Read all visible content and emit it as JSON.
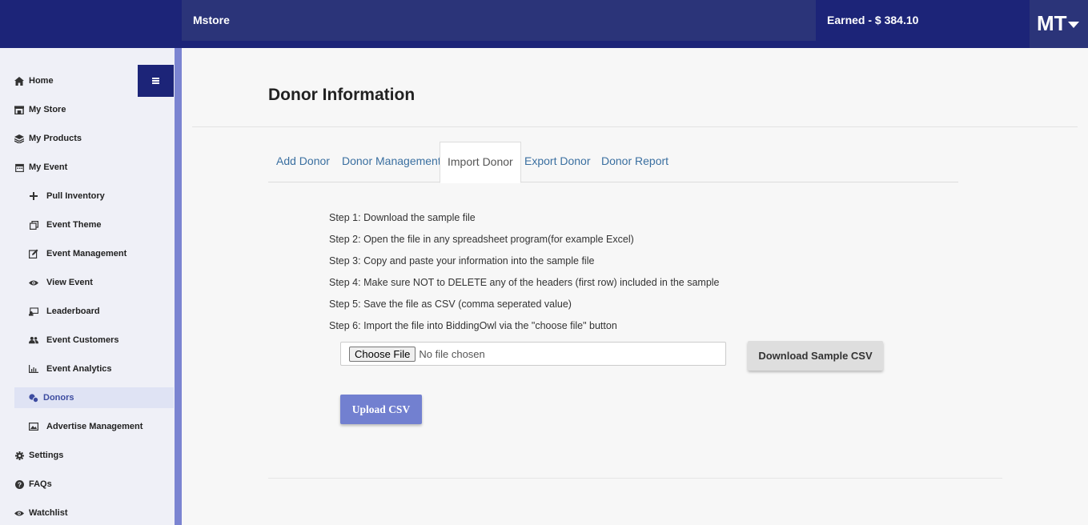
{
  "topbar": {
    "store_name": "Mstore",
    "earned": "Earned - $ 384.10",
    "avatar_initials": "MT"
  },
  "sidebar": {
    "items": [
      {
        "label": "Home",
        "icon": "home-icon"
      },
      {
        "label": "My Store",
        "icon": "store-icon"
      },
      {
        "label": "My Products",
        "icon": "layers-icon"
      },
      {
        "label": "My Event",
        "icon": "calendar-icon"
      },
      {
        "label": "Pull Inventory",
        "icon": "plus-icon"
      },
      {
        "label": "Event Theme",
        "icon": "copy-icon"
      },
      {
        "label": "Event Management",
        "icon": "edit-icon"
      },
      {
        "label": "View Event",
        "icon": "eye-icon"
      },
      {
        "label": "Leaderboard",
        "icon": "leaderboard-icon"
      },
      {
        "label": "Event Customers",
        "icon": "users-icon"
      },
      {
        "label": "Event Analytics",
        "icon": "chart-icon"
      },
      {
        "label": "Donors",
        "icon": "donors-icon"
      },
      {
        "label": "Advertise Management",
        "icon": "ad-icon"
      },
      {
        "label": "Settings",
        "icon": "gear-icon"
      },
      {
        "label": "FAQs",
        "icon": "question-icon"
      },
      {
        "label": "Watchlist",
        "icon": "eye-icon"
      }
    ],
    "active_item": "Donors"
  },
  "main": {
    "title": "Donor Information",
    "tabs": [
      {
        "label": "Add Donor"
      },
      {
        "label": "Donor Management"
      },
      {
        "label": "Import Donor"
      },
      {
        "label": "Export Donor"
      },
      {
        "label": "Donor Report"
      }
    ],
    "active_tab": "Import Donor",
    "steps": [
      "Step 1: Download the sample file",
      "Step 2: Open the file in any spreadsheet program(for example Excel)",
      "Step 3: Copy and paste your information into the sample file",
      "Step 4: Make sure NOT to DELETE any of the headers (first row) included in the sample",
      "Step 5: Save the file as CSV (comma seperated value)",
      "Step 6: Import the file into BiddingOwl via the \"choose file\" button"
    ],
    "file_input": {
      "button_label": "Choose File",
      "status": "No file chosen"
    },
    "download_sample_label": "Download Sample CSV",
    "upload_label": "Upload CSV"
  },
  "colors": {
    "topbar": "#1c2478",
    "accent": "#7280d0",
    "sidebar_bg": "#eff0f7",
    "link": "#3a6fa0"
  }
}
